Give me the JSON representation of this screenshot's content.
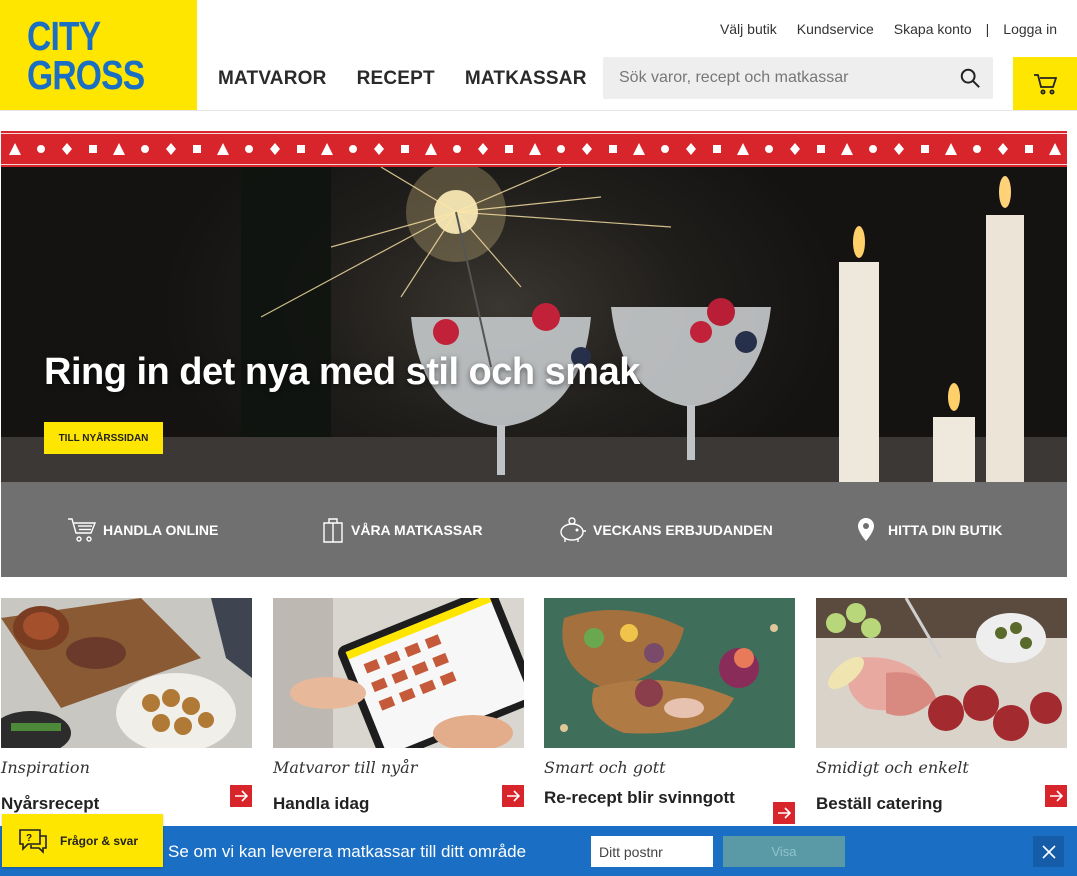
{
  "brand": {
    "line1": "CITY",
    "line2": "GROSS",
    "yellow": "#ffe600",
    "blue": "#1a6fc4",
    "red": "#d7252b"
  },
  "toplinks": {
    "store": "Välj butik",
    "service": "Kundservice",
    "create": "Skapa konto",
    "sep": "|",
    "login": "Logga in"
  },
  "nav": [
    "MATVAROR",
    "RECEPT",
    "MATKASSAR"
  ],
  "search": {
    "placeholder": "Sök varor, recept och matkassar",
    "icon": "search-icon"
  },
  "cart": {
    "icon": "cart-icon"
  },
  "hero": {
    "title": "Ring in det nya med stil och smak",
    "button": "TILL NYÅRSSIDAN"
  },
  "quick": [
    {
      "label": "HANDLA ONLINE",
      "icon": "shopping-cart-icon"
    },
    {
      "label": "VÅRA MATKASSAR",
      "icon": "bag-icon"
    },
    {
      "label": "VECKANS ERBJUDANDEN",
      "icon": "piggy-bank-icon"
    },
    {
      "label": "HITTA DIN BUTIK",
      "icon": "location-pin-icon"
    }
  ],
  "cards": [
    {
      "tag": "Inspiration",
      "title": "Nyårsrecept"
    },
    {
      "tag": "Matvaror till nyår",
      "title": "Handla idag"
    },
    {
      "tag": "Smart och gott",
      "title": "Re-recept blir svinngott"
    },
    {
      "tag": "Smidigt och enkelt",
      "title": "Beställ catering"
    }
  ],
  "bottombar": {
    "text": "Se om vi kan leverera matkassar till ditt område",
    "placeholder": "Ditt postnr",
    "button": "Visa"
  },
  "faq": {
    "label": "Frågor & svar"
  }
}
